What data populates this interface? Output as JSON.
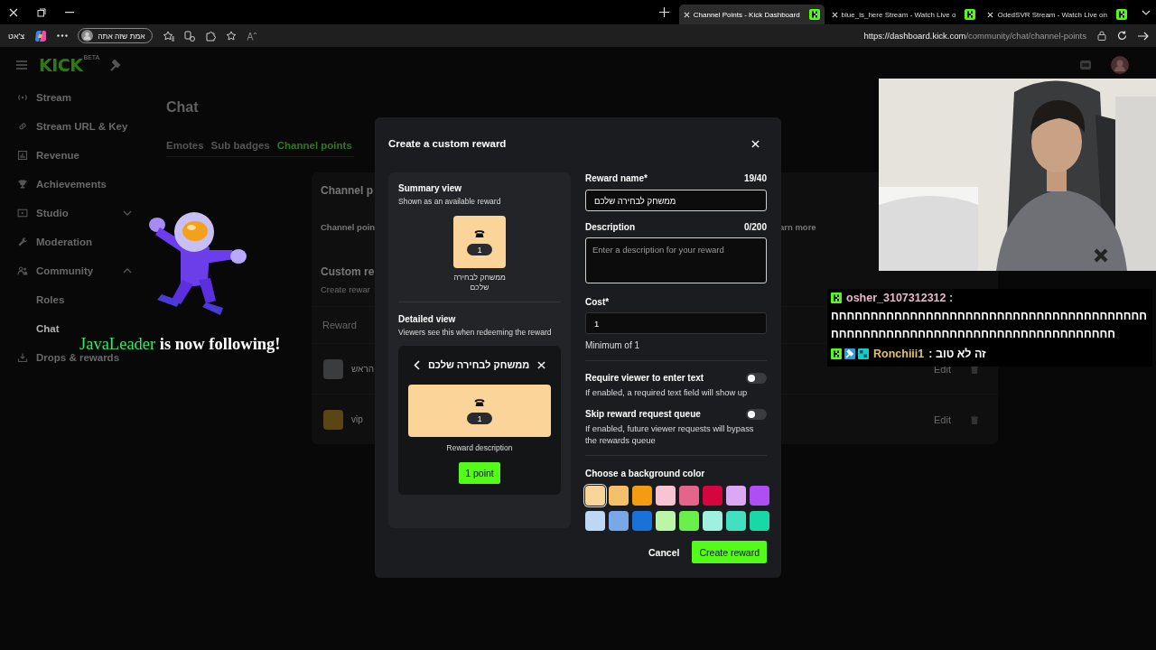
{
  "browser": {
    "tabs": [
      {
        "title": "Channel Points - Kick Dashboard",
        "selected": true
      },
      {
        "title": "blue_is_here Stream - Watch Live o",
        "selected": false
      },
      {
        "title": "OdedSVR Stream - Watch Live on",
        "selected": false
      }
    ],
    "chat_button": "צ'אט",
    "profile": "אמת שזה אתה",
    "url_host": "https://dashboard.kick.com",
    "url_path": "/community/chat/channel-points"
  },
  "dashboard": {
    "logo": "KICK",
    "logo_badge": "BETA",
    "sidebar": [
      {
        "label": "Stream",
        "selected": false
      },
      {
        "label": "Stream URL & Key",
        "selected": false
      },
      {
        "label": "Revenue",
        "selected": false
      },
      {
        "label": "Achievements",
        "selected": false
      },
      {
        "label": "Studio",
        "selected": false,
        "expanded": false
      },
      {
        "label": "Moderation",
        "selected": false
      },
      {
        "label": "Community",
        "selected": false,
        "expanded": true,
        "children": [
          {
            "label": "Roles",
            "selected": false
          },
          {
            "label": "Chat",
            "selected": true
          }
        ]
      },
      {
        "label": "Drops & rewards",
        "selected": false
      }
    ],
    "title": "Chat",
    "tabs": [
      {
        "label": "Emotes",
        "selected": false
      },
      {
        "label": "Sub badges",
        "selected": false
      },
      {
        "label": "Channel points",
        "selected": true
      }
    ],
    "card": {
      "heading": "Channel p",
      "subtext": "Channel poin",
      "link": "arn more",
      "section_title": "Custom re",
      "section_subtitle": "Create rewar",
      "column_1": "Reward",
      "rows": [
        {
          "name": "הראש",
          "color": "#3b3c3e",
          "action": "Edit"
        },
        {
          "name": "vip",
          "color": "#5c4515",
          "action": "Edit"
        }
      ]
    }
  },
  "alert": {
    "follower": "JavaLeader",
    "message": "is now following!"
  },
  "chat": [
    {
      "badges": [
        {
          "kind": "kick"
        }
      ],
      "name": "osher_3107312312 :",
      "color": "#e9b7c9",
      "text": "חחחחחחחחחחחחחחחחחחחחחחחחחחחחחחחחחחחחחחחחחחחחחחחחחחחחחחחחחחחחחחחחחחחחחחחחחחחח"
    },
    {
      "badges": [
        {
          "kind": "kick"
        },
        {
          "kind": "moderator"
        },
        {
          "kind": "og"
        }
      ],
      "name": "Ronchiii1",
      "color": "#e8c15c",
      "text": ": זה לא טוב"
    }
  ],
  "modal": {
    "title": "Create a custom reward",
    "summary": {
      "heading": "Summary view",
      "subheading": "Shown as an available reward",
      "cost": "1",
      "name": "ממשחק לבחירה שלכם"
    },
    "detailed": {
      "heading": "Detailed view",
      "subheading": "Viewers see this when redeeming the reward",
      "name": "ממשחק לבחירה שלכם",
      "cost": "1",
      "description": "Reward description",
      "button": "1 point"
    },
    "reward_name": {
      "label": "Reward name*",
      "counter": "19/40",
      "value": "ממשחק לבחירה שלכם"
    },
    "description": {
      "label": "Description",
      "counter": "0/200",
      "placeholder": "Enter a description for your reward"
    },
    "cost": {
      "label": "Cost*",
      "value": "1",
      "hint": "Minimum of 1"
    },
    "toggles": [
      {
        "label": "Require viewer to enter text",
        "help": "If enabled, a required text field will show up",
        "on": false
      },
      {
        "label": "Skip reward request queue",
        "help": "If enabled, future viewer requests will bypass the rewards queue",
        "on": false
      }
    ],
    "colors": {
      "label": "Choose a background color",
      "swatches": [
        {
          "color": "#fbd49a",
          "selected": true
        },
        {
          "color": "#f5c06a",
          "selected": false
        },
        {
          "color": "#f39c12",
          "selected": false
        },
        {
          "color": "#f8c4d4",
          "selected": false
        },
        {
          "color": "#e5648a",
          "selected": false
        },
        {
          "color": "#d5063d",
          "selected": false
        },
        {
          "color": "#dca8f5",
          "selected": false
        },
        {
          "color": "#b04ef5",
          "selected": false
        },
        {
          "color": "#bcd8f5",
          "selected": false
        },
        {
          "color": "#78a8e8",
          "selected": false
        },
        {
          "color": "#1a72d8",
          "selected": false
        },
        {
          "color": "#bdf5a8",
          "selected": false
        },
        {
          "color": "#6af04a",
          "selected": false
        },
        {
          "color": "#a0f0e0",
          "selected": false
        },
        {
          "color": "#40e0c0",
          "selected": false
        },
        {
          "color": "#18d8a8",
          "selected": false
        }
      ]
    },
    "cancel": "Cancel",
    "submit": "Create reward"
  }
}
